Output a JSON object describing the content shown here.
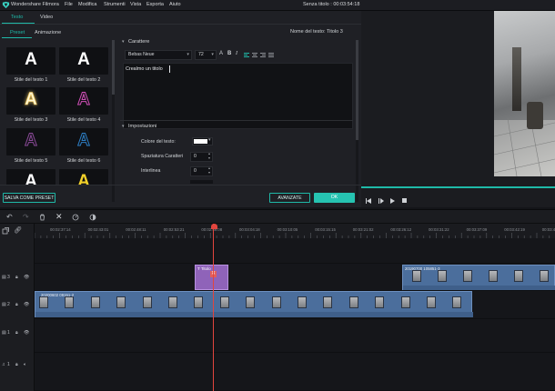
{
  "app": {
    "name": "Wondershare Filmora",
    "window_title": "Senza titolo : 00:03:54:18"
  },
  "menu": [
    "File",
    "Modifica",
    "Strumenti",
    "Vista",
    "Esporta",
    "Aiuto"
  ],
  "top_tabs": {
    "text": "Testo",
    "video": "Video"
  },
  "sub_tabs": {
    "preset": "Preset",
    "animation": "Animazione"
  },
  "text_name": "Nome del testo: Titolo 3",
  "presets": [
    {
      "glyph": "A",
      "label": "Stile del testo 1",
      "color": "#ffffff",
      "style": "plain"
    },
    {
      "glyph": "A",
      "label": "Stile del testo 2",
      "color": "#ffffff",
      "style": "plain"
    },
    {
      "glyph": "A",
      "label": "Stile del testo 3",
      "color": "#fff6d2",
      "style": "glow"
    },
    {
      "glyph": "A",
      "label": "Stile del testo 4",
      "color": "#d14fb8",
      "style": "outline"
    },
    {
      "glyph": "A",
      "label": "Stile del testo 5",
      "color": "#8a4a98",
      "style": "outline"
    },
    {
      "glyph": "A",
      "label": "Stile del testo 6",
      "color": "#2c7ec4",
      "style": "outline"
    },
    {
      "glyph": "A",
      "label": "",
      "color": "#ffffff",
      "style": "plain"
    },
    {
      "glyph": "A",
      "label": "",
      "color": "#f3d12a",
      "style": "plain"
    }
  ],
  "character": {
    "header": "Carattere",
    "font": "Bebas Neue",
    "size": "72",
    "content": "Crealmo un titolo"
  },
  "settings": {
    "header": "Impostazioni",
    "color_label": "Colore del testo:",
    "color_value": "#ffffff",
    "spacing_label": "Spaziatura Caratteri",
    "spacing_value": "0",
    "line_label": "Interlinea",
    "line_value": "0"
  },
  "buttons": {
    "save_preset": "SALVA COME PRESET",
    "advanced": "AVANZATE",
    "ok": "OK"
  },
  "ruler": [
    "00:02:37:14",
    "00:02:43:01",
    "00:02:48:11",
    "00:02:53:21",
    "00:02:59:08",
    "00:03:04:18",
    "00:03:10:05",
    "00:03:15:15",
    "00:03:21:02",
    "00:03:26:12",
    "00:03:31:22",
    "00:03:37:09",
    "00:03:42:19",
    "00:03:4"
  ],
  "tracks": [
    {
      "label": "3"
    },
    {
      "label": "2"
    },
    {
      "label": "1"
    },
    {
      "label": "1"
    }
  ],
  "clips": {
    "title_clip": "T Titolo",
    "clip_top_right": "20190700 105851-3",
    "clip_main": "20200602 09151-2"
  },
  "colors": {
    "accent": "#1fb9a8",
    "playhead": "#e2453e",
    "title_clip": "#9b6ac8"
  }
}
